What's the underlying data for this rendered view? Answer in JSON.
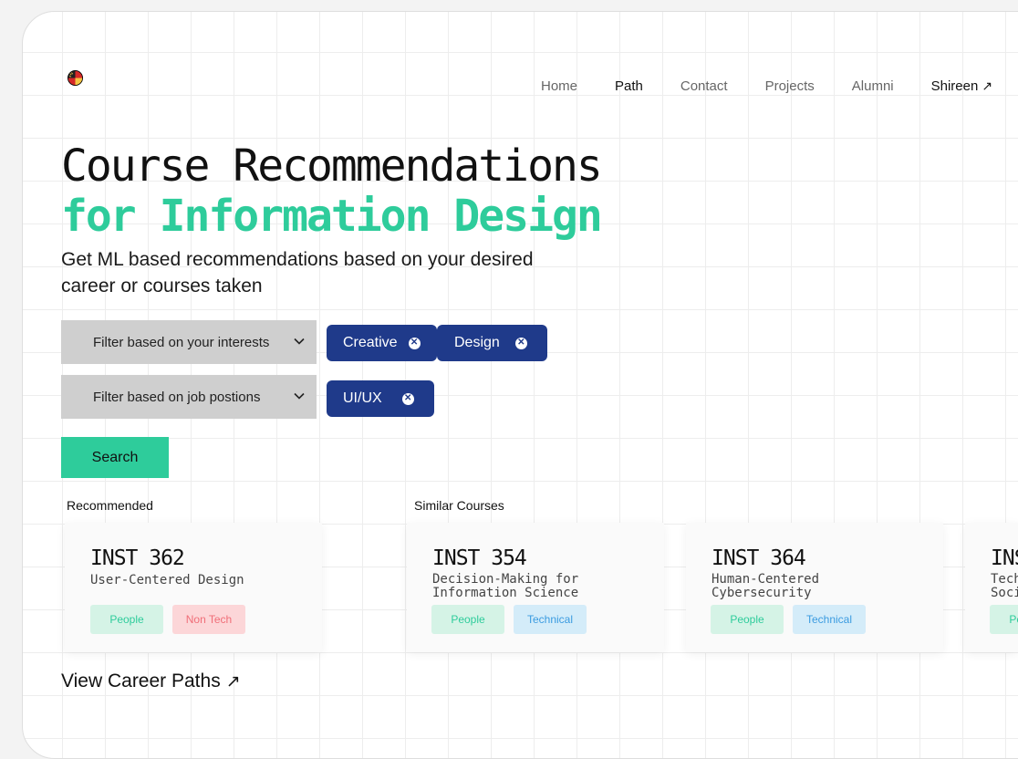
{
  "nav": {
    "items": [
      "Home",
      "Path",
      "Contact",
      "Projects",
      "Alumni"
    ],
    "active": "Path",
    "user": "Shireen",
    "user_arrow": "↗"
  },
  "hero": {
    "title": "Course Recommendations",
    "subtitle": "for Information Design",
    "description": "Get ML based recommendations based on your desired career or courses taken"
  },
  "filters": {
    "interests": {
      "label": "Filter based on your interests",
      "chips": [
        "Creative",
        "Design"
      ]
    },
    "jobs": {
      "label": "Filter based on job postions",
      "chips": [
        "UI/UX"
      ]
    }
  },
  "search_label": "Search",
  "sections": {
    "recommended": "Recommended",
    "similar": "Similar Courses"
  },
  "courses": [
    {
      "code": "INST 362",
      "name_lines": [
        "User-Centered Design"
      ],
      "tags": [
        "People",
        "Non Tech"
      ]
    },
    {
      "code": "INST 354",
      "name_lines": [
        "Decision-Making for",
        "Information Science"
      ],
      "tags": [
        "People",
        "Technical"
      ]
    },
    {
      "code": "INST 364",
      "name_lines": [
        "Human-Centered",
        "Cybersecurity"
      ],
      "tags": [
        "People",
        "Technical"
      ]
    },
    {
      "code": "INST",
      "name_lines": [
        "Tech",
        "Soci"
      ],
      "tags": [
        "People"
      ]
    }
  ],
  "career_link": "View Career Paths",
  "career_arrow": "↗",
  "colors": {
    "accent": "#2ecc9b",
    "chip": "#1f3a8a",
    "filter_bg": "#cfcfcf"
  }
}
